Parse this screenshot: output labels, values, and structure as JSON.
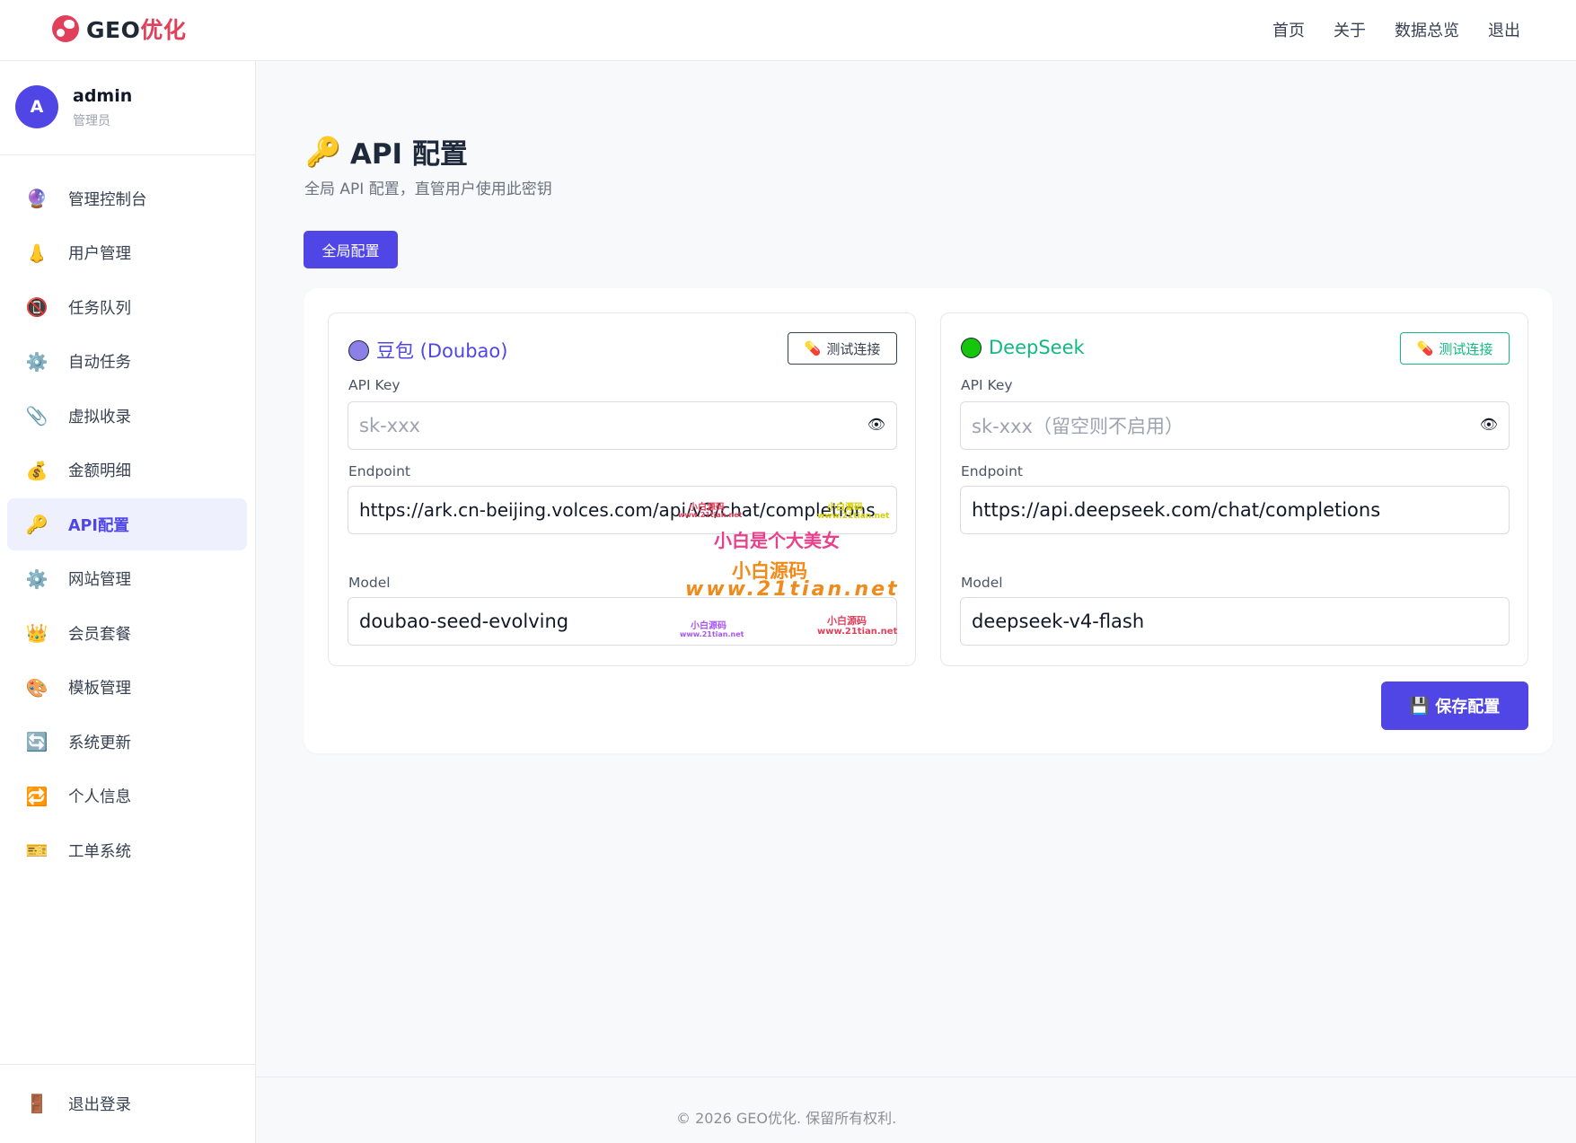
{
  "brand": {
    "prefix": "GEO",
    "accent": "优化",
    "logo_icon": "globe-icon"
  },
  "topnav": [
    "首页",
    "关于",
    "数据总览",
    "退出"
  ],
  "user": {
    "avatar_letter": "A",
    "name": "admin",
    "role": "管理员"
  },
  "sidebar": {
    "items": [
      {
        "icon": "🔮",
        "label": "管理控制台",
        "icon_name": "crystal-ball-icon"
      },
      {
        "icon": "👃",
        "label": "用户管理",
        "icon_name": "user-icon"
      },
      {
        "icon": "📵",
        "label": "任务队列",
        "icon_name": "queue-icon"
      },
      {
        "icon": "⚙️",
        "label": "自动任务",
        "icon_name": "gear-icon"
      },
      {
        "icon": "📎",
        "label": "虚拟收录",
        "icon_name": "clip-icon"
      },
      {
        "icon": "💰",
        "label": "金额明细",
        "icon_name": "money-bag-icon"
      },
      {
        "icon": "🔑",
        "label": "API配置",
        "icon_name": "key-icon",
        "active": true
      },
      {
        "icon": "⚙️",
        "label": "网站管理",
        "icon_name": "gear-icon"
      },
      {
        "icon": "👑",
        "label": "会员套餐",
        "icon_name": "crown-icon"
      },
      {
        "icon": "🎨",
        "label": "模板管理",
        "icon_name": "palette-icon"
      },
      {
        "icon": "🔄",
        "label": "系统更新",
        "icon_name": "refresh-icon"
      },
      {
        "icon": "🔁",
        "label": "个人信息",
        "icon_name": "repeat-icon"
      },
      {
        "icon": "🎫",
        "label": "工单系统",
        "icon_name": "ticket-icon"
      }
    ],
    "logout": {
      "icon": "🚪",
      "label": "退出登录",
      "icon_name": "door-icon"
    }
  },
  "page": {
    "title_icon": "🔑",
    "title": "API 配置",
    "subtitle": "全局 API 配置，直管用户使用此密钥",
    "tab": "全局配置"
  },
  "providers": [
    {
      "name": "豆包 (Doubao)",
      "dot_color": "#8b7fe8",
      "name_color": "#4f46e5",
      "test_label": "测试连接",
      "test_color": "#374151",
      "api_key_label": "API Key",
      "api_key_placeholder": "sk-xxx",
      "endpoint_label": "Endpoint",
      "endpoint_value": "https://ark.cn-beijing.volces.com/api/v3/chat/completions",
      "model_label": "Model",
      "model_value": "doubao-seed-evolving"
    },
    {
      "name": "DeepSeek",
      "dot_color": "#16c60c",
      "name_color": "#10b981",
      "test_label": "测试连接",
      "test_color": "#10b981",
      "api_key_label": "API Key",
      "api_key_placeholder": "sk-xxx（留空则不启用）",
      "endpoint_label": "Endpoint",
      "endpoint_value": "https://api.deepseek.com/chat/completions",
      "model_label": "Model",
      "model_value": "deepseek-v4-flash"
    }
  ],
  "save_label": "保存配置",
  "save_icon": "💾",
  "footer": "© 2026 GEO优化. 保留所有权利.",
  "watermark": {
    "line1": "小白是个大美女",
    "line2": "小白源码",
    "line3": "www.21tian.net",
    "small1": "小白源码",
    "small2": "www.21tian.net"
  }
}
